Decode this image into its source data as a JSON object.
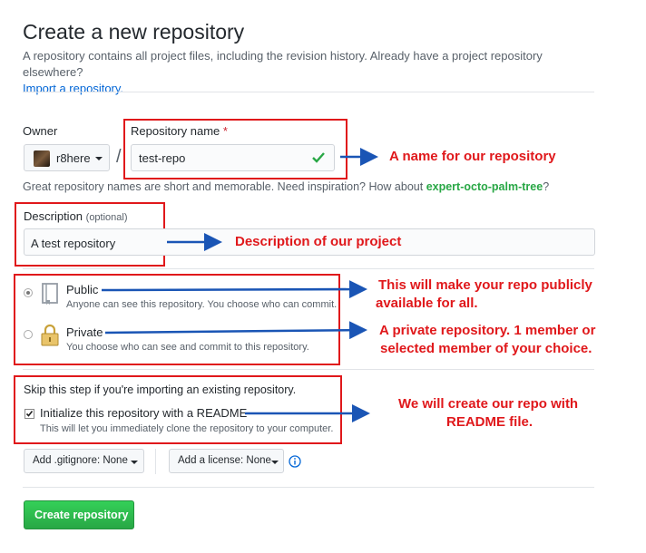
{
  "header": {
    "title": "Create a new repository",
    "description": "A repository contains all project files, including the revision history. Already have a project repository elsewhere?",
    "import_link": "Import a repository."
  },
  "owner": {
    "label": "Owner",
    "value": "r8here"
  },
  "repo_name": {
    "label": "Repository name",
    "required_mark": "*",
    "value": "test-repo"
  },
  "name_hint": {
    "text": "Great repository names are short and memorable. Need inspiration? How about",
    "suggestion": "expert-octo-palm-tree",
    "end": "?"
  },
  "description": {
    "label": "Description",
    "optional": "(optional)",
    "value": "A test repository"
  },
  "visibility": {
    "public": {
      "label": "Public",
      "note": "Anyone can see this repository. You choose who can commit.",
      "selected": true
    },
    "private": {
      "label": "Private",
      "note": "You choose who can see and commit to this repository.",
      "selected": false
    }
  },
  "init": {
    "skip_note": "Skip this step if you're importing an existing repository.",
    "readme_label": "Initialize this repository with a README",
    "readme_note": "This will let you immediately clone the repository to your computer.",
    "checked": true
  },
  "gitignore_button": "Add .gitignore: None",
  "license_button": "Add a license: None",
  "create_button": "Create repository",
  "annotations": {
    "name": "A name for our repository",
    "description": "Description of our project",
    "public_1": "This will make your repo publicly",
    "public_2": "available for all.",
    "private_1": "A private repository. 1 member or",
    "private_2": "selected member of your choice.",
    "readme_1": "We will create our repo with",
    "readme_2": "README file."
  },
  "colors": {
    "annotation_red": "#e0181b",
    "arrow_blue": "#1a55b5",
    "create_green": "#2ea44f",
    "link_blue": "#0366d6",
    "check_green": "#28a745"
  }
}
